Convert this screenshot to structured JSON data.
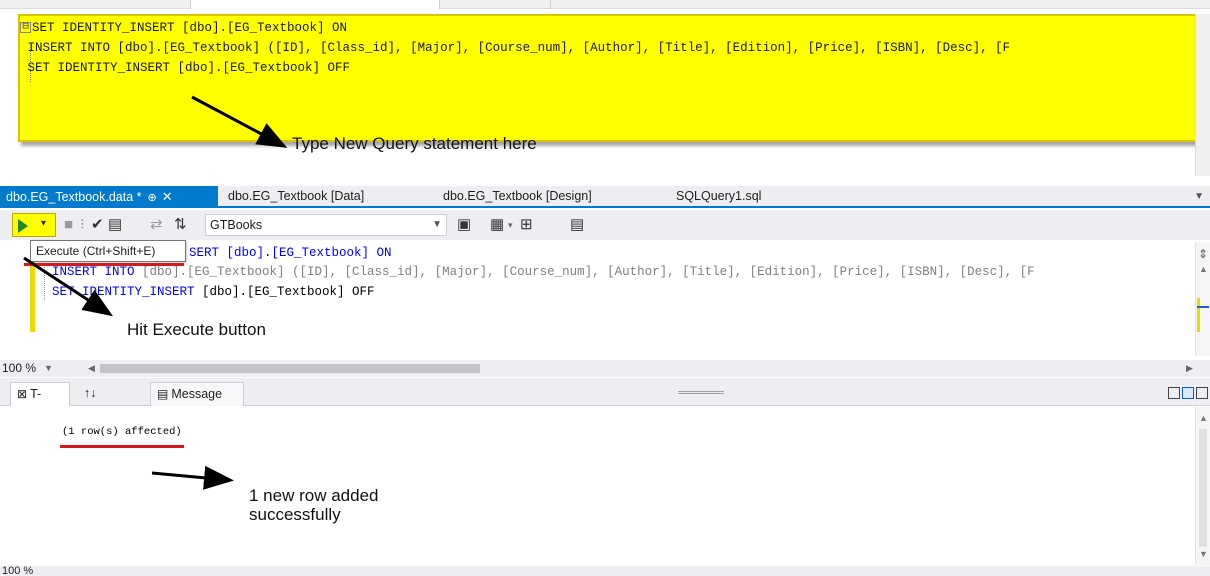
{
  "top_editor": {
    "collapse_glyph": "⊟",
    "lines": [
      "SET IDENTITY_INSERT [dbo].[EG_Textbook] ON",
      " INSERT INTO [dbo].[EG_Textbook] ([ID], [Class_id], [Major], [Course_num], [Author], [Title], [Edition], [Price], [ISBN], [Desc], [F",
      " SET IDENTITY_INSERT [dbo].[EG_Textbook] OFF"
    ]
  },
  "annotations": {
    "type_query": "Type New Query statement here",
    "hit_execute": "Hit Execute button",
    "new_row_line1": "1 new row added",
    "new_row_line2": "successfully"
  },
  "doc_tabs": [
    {
      "label": "dbo.EG_Textbook.data *",
      "active": true,
      "pin": "⊕",
      "close": "✕"
    },
    {
      "label": "dbo.EG_Textbook [Data]",
      "active": false
    },
    {
      "label": "dbo.EG_Textbook [Design]",
      "active": false
    },
    {
      "label": "SQLQuery1.sql",
      "active": false
    }
  ],
  "toolbar": {
    "execute_icon": "play-icon",
    "execute_dropdown": "▾",
    "database": "GTBooks",
    "tooltip": "Execute (Ctrl+Shift+E)"
  },
  "editor": {
    "line1_visible": "SERT [dbo].[EG_Textbook] ON",
    "line2_kw": "INSERT INTO",
    "line2_rest": " [dbo].[EG_Textbook] ([ID], [Class_id], [Major], [Course_num], [Author], [Title], [Edition], [Price], [ISBN], [Desc], [F",
    "line3_kw": "SET IDENTITY_INSERT",
    "line3_rest": " [dbo].[EG_Textbook] OFF"
  },
  "zoom": {
    "value": "100 %",
    "bottom_value": "100 %"
  },
  "result_tabs": {
    "tsql": "T-SQL",
    "sort": "↑↓",
    "message": "Message"
  },
  "results": {
    "message": "(1 row(s) affected)"
  },
  "colors": {
    "highlight_yellow": "#ffff00",
    "accent_blue": "#007acc",
    "underline_red": "#d41a1a",
    "sql_keyword": "#0000ff"
  }
}
